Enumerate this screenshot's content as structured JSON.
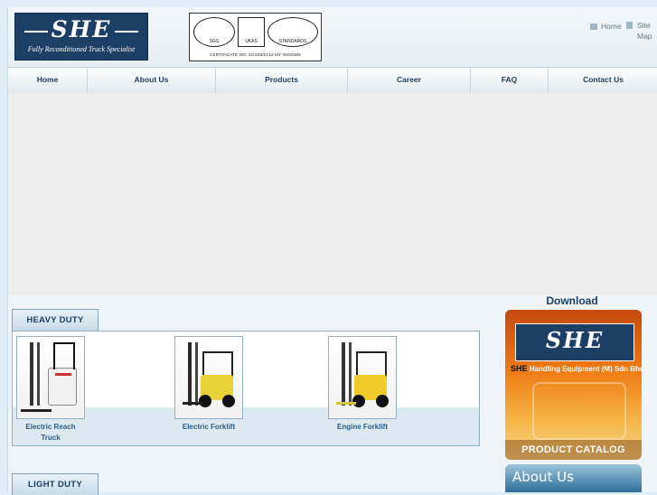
{
  "header": {
    "logo_brand": "SHE",
    "logo_tagline": "Fully Reconditioned Truck Specialist",
    "cert_labels": [
      "SGS",
      "UKAS",
      "STANDARDS"
    ],
    "cert_line": "CERTIFICATE NO: SGS09/0212      MY 09/00385",
    "top_links": {
      "home": "Home",
      "site_map": "Site Map"
    }
  },
  "nav": {
    "items": [
      "Home",
      "About Us",
      "Products",
      "Career",
      "FAQ",
      "Contact Us"
    ]
  },
  "heavy_duty": {
    "title": "HEAVY DUTY",
    "products": [
      {
        "label": "Electric Reach Truck"
      },
      {
        "label": "Electric Forklift"
      },
      {
        "label": "Engine Forklift"
      }
    ]
  },
  "light_duty": {
    "title": "LIGHT DUTY"
  },
  "sidebar": {
    "download_title": "Download",
    "catalog": {
      "brand": "SHE",
      "company_prefix": "SHE",
      "company": "Handling Equipment (M) Sdn Bhd",
      "label": "PRODUCT CATALOG"
    },
    "about_label": "About Us"
  }
}
